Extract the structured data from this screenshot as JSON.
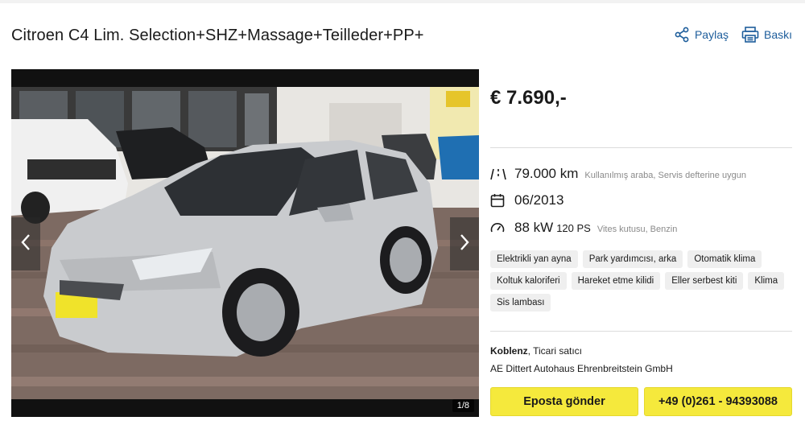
{
  "listing": {
    "title": "Citroen C4 Lim. Selection+SHZ+Massage+Teilleder+PP+"
  },
  "actions": {
    "share_label": "Paylaş",
    "print_label": "Baskı"
  },
  "gallery": {
    "counter": "1/8"
  },
  "price": "€ 7.690,-",
  "specs": {
    "mileage": "79.000 km",
    "mileage_note": "Kullanılmış araba, Servis defterine uygun",
    "registration": "06/2013",
    "power_kw": "88 kW",
    "power_ps": "120 PS",
    "power_note": "Vites kutusu, Benzin"
  },
  "features": [
    "Elektrikli yan ayna",
    "Park yardımcısı, arka",
    "Otomatik klima",
    "Koltuk kaloriferi",
    "Hareket etme kilidi",
    "Eller serbest kiti",
    "Klima",
    "Sis lambası"
  ],
  "seller": {
    "city": "Koblenz",
    "type": ", Ticari satıcı",
    "dealer_name": "AE Dittert Autohaus Ehrenbreitstein GmbH"
  },
  "contact": {
    "email_label": "Eposta gönder",
    "phone_label": "+49 (0)261 - 94393088"
  },
  "colors": {
    "link_blue": "#1d5d9b",
    "button_yellow": "#f5e93c"
  }
}
